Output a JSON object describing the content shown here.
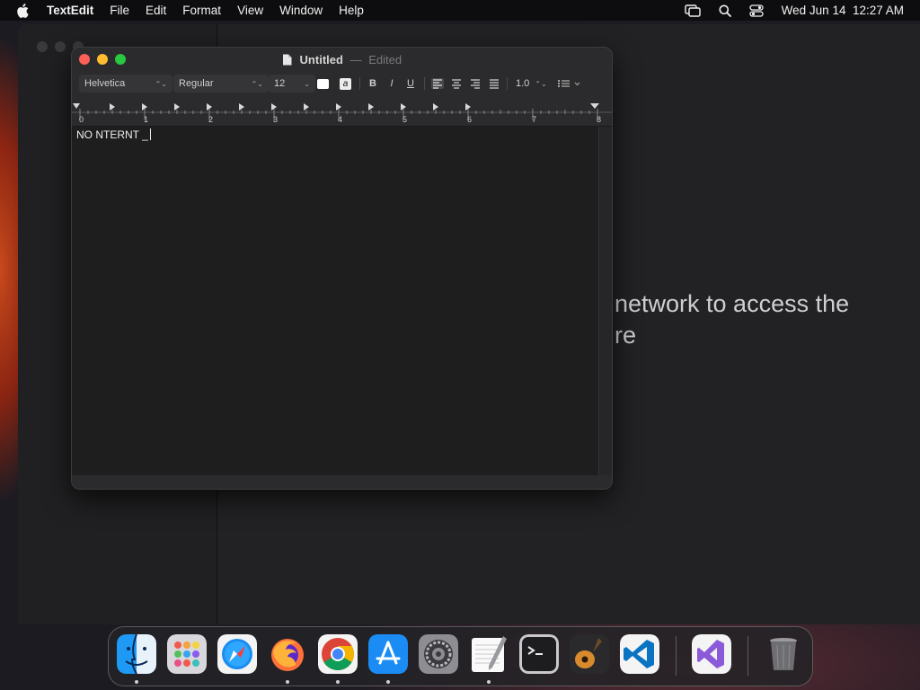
{
  "menubar": {
    "app_name": "TextEdit",
    "items": [
      "File",
      "Edit",
      "Format",
      "View",
      "Window",
      "Help"
    ],
    "datetime": "Wed Jun 14  12:27 AM"
  },
  "background_window": {
    "message_line1": "network to access the",
    "message_line2": "re"
  },
  "textedit": {
    "title": "Untitled",
    "separator": "—",
    "state": "Edited",
    "toolbar": {
      "font_family": "Helvetica",
      "font_style": "Regular",
      "font_size": "12",
      "bold": "B",
      "italic": "I",
      "underline": "U",
      "line_spacing": "1.0",
      "text_color_glyph": "a"
    },
    "ruler_numbers": [
      "0",
      "1",
      "2",
      "3",
      "4",
      "5",
      "6",
      "7",
      "8"
    ],
    "document_text": "NO NTERNT _"
  },
  "dock": {
    "apps": [
      "Finder",
      "Launchpad",
      "Safari",
      "Firefox",
      "Google Chrome",
      "App Store",
      "System Settings",
      "TextEdit",
      "Terminal",
      "GarageBand",
      "Visual Studio Code",
      "Visual Studio",
      "Trash"
    ]
  }
}
